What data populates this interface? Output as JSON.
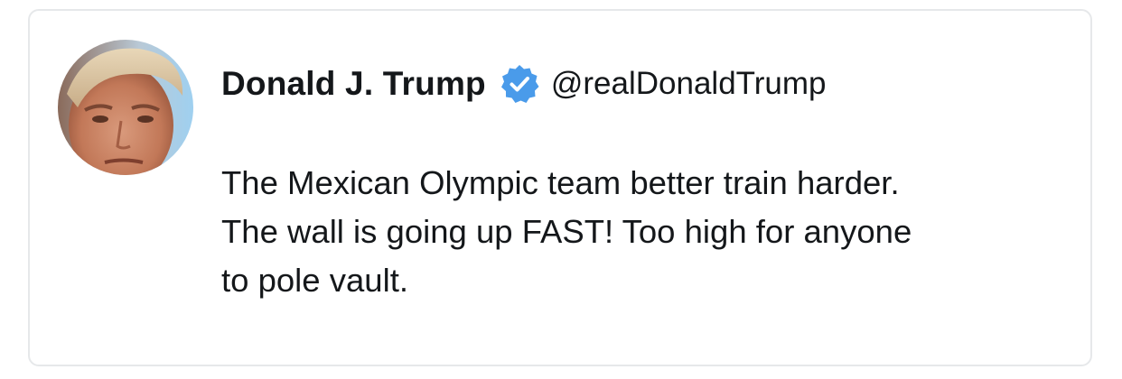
{
  "tweet": {
    "author": {
      "display_name": "Donald J. Trump",
      "handle": "@realDonaldTrump",
      "verified": true
    },
    "text": "The Mexican Olympic team better train harder.\nThe wall is going up FAST! Too high for anyone\nto pole vault."
  },
  "icons": {
    "avatar": "user-avatar",
    "verified": "verified-badge-icon"
  },
  "colors": {
    "verified_blue": "#4a9bea",
    "text": "#14171a",
    "card_border": "#e6e8ea"
  }
}
